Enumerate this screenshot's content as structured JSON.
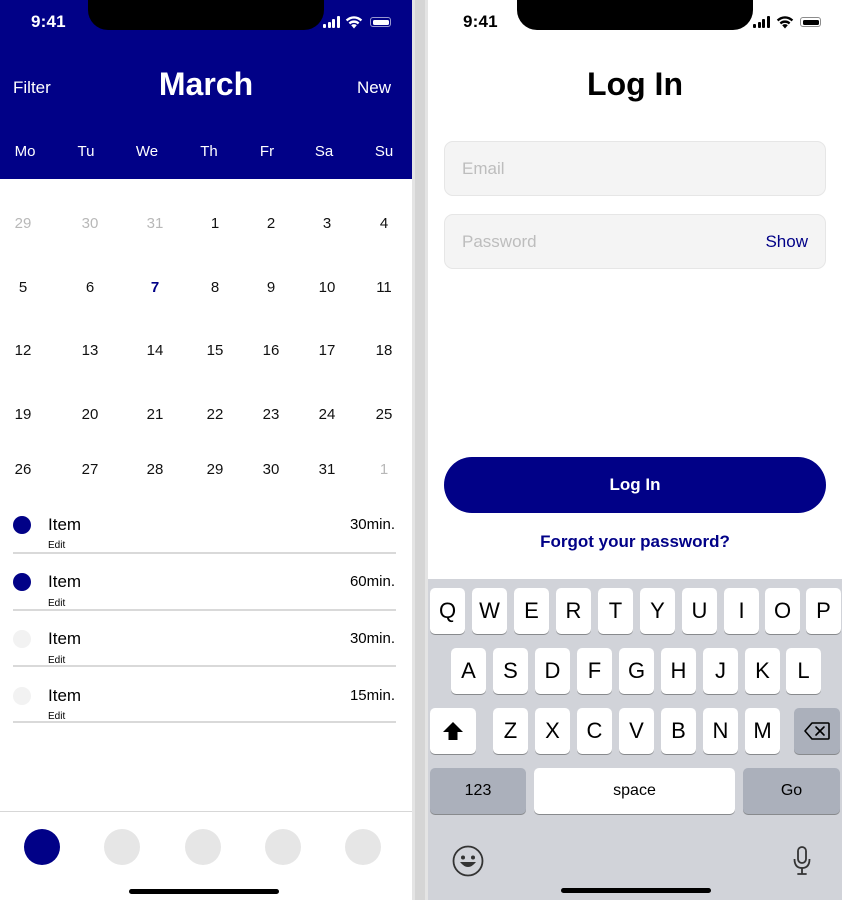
{
  "calendar_screen": {
    "status_time": "9:41",
    "header": {
      "filter_label": "Filter",
      "month": "March",
      "new_label": "New"
    },
    "weekdays": [
      "Mo",
      "Tu",
      "We",
      "Th",
      "Fr",
      "Sa",
      "Su"
    ],
    "weeks": [
      [
        "29",
        "30",
        "31",
        "1",
        "2",
        "3",
        "4"
      ],
      [
        "5",
        "6",
        "7",
        "8",
        "9",
        "10",
        "11"
      ],
      [
        "12",
        "13",
        "14",
        "15",
        "16",
        "17",
        "18"
      ],
      [
        "19",
        "20",
        "21",
        "22",
        "23",
        "24",
        "25"
      ],
      [
        "26",
        "27",
        "28",
        "29",
        "30",
        "31",
        "1"
      ]
    ],
    "today": "7",
    "items": [
      {
        "title": "Item",
        "sub": "Edit",
        "duration": "30min.",
        "active": true
      },
      {
        "title": "Item",
        "sub": "Edit",
        "duration": "60min.",
        "active": true
      },
      {
        "title": "Item",
        "sub": "Edit",
        "duration": "30min.",
        "active": false
      },
      {
        "title": "Item",
        "sub": "Edit",
        "duration": "15min.",
        "active": false
      }
    ],
    "tabbar_tabs": 5,
    "active_tab": 0
  },
  "login_screen": {
    "status_time": "9:41",
    "title": "Log In",
    "email_placeholder": "Email",
    "password_placeholder": "Password",
    "show_label": "Show",
    "login_button": "Log In",
    "forgot_label": "Forgot your password?",
    "keyboard": {
      "row1": [
        "Q",
        "W",
        "E",
        "R",
        "T",
        "Y",
        "U",
        "I",
        "O",
        "P"
      ],
      "row2": [
        "A",
        "S",
        "D",
        "F",
        "G",
        "H",
        "J",
        "K",
        "L"
      ],
      "row3": [
        "Z",
        "X",
        "C",
        "V",
        "B",
        "N",
        "M"
      ],
      "numbers_label": "123",
      "space_label": "space",
      "go_label": "Go"
    }
  },
  "colors": {
    "brand": "#010187",
    "keyboard_bg": "#d1d3d9",
    "field_bg": "#f4f4f4",
    "inactive_dot": "#f2f2f2"
  }
}
